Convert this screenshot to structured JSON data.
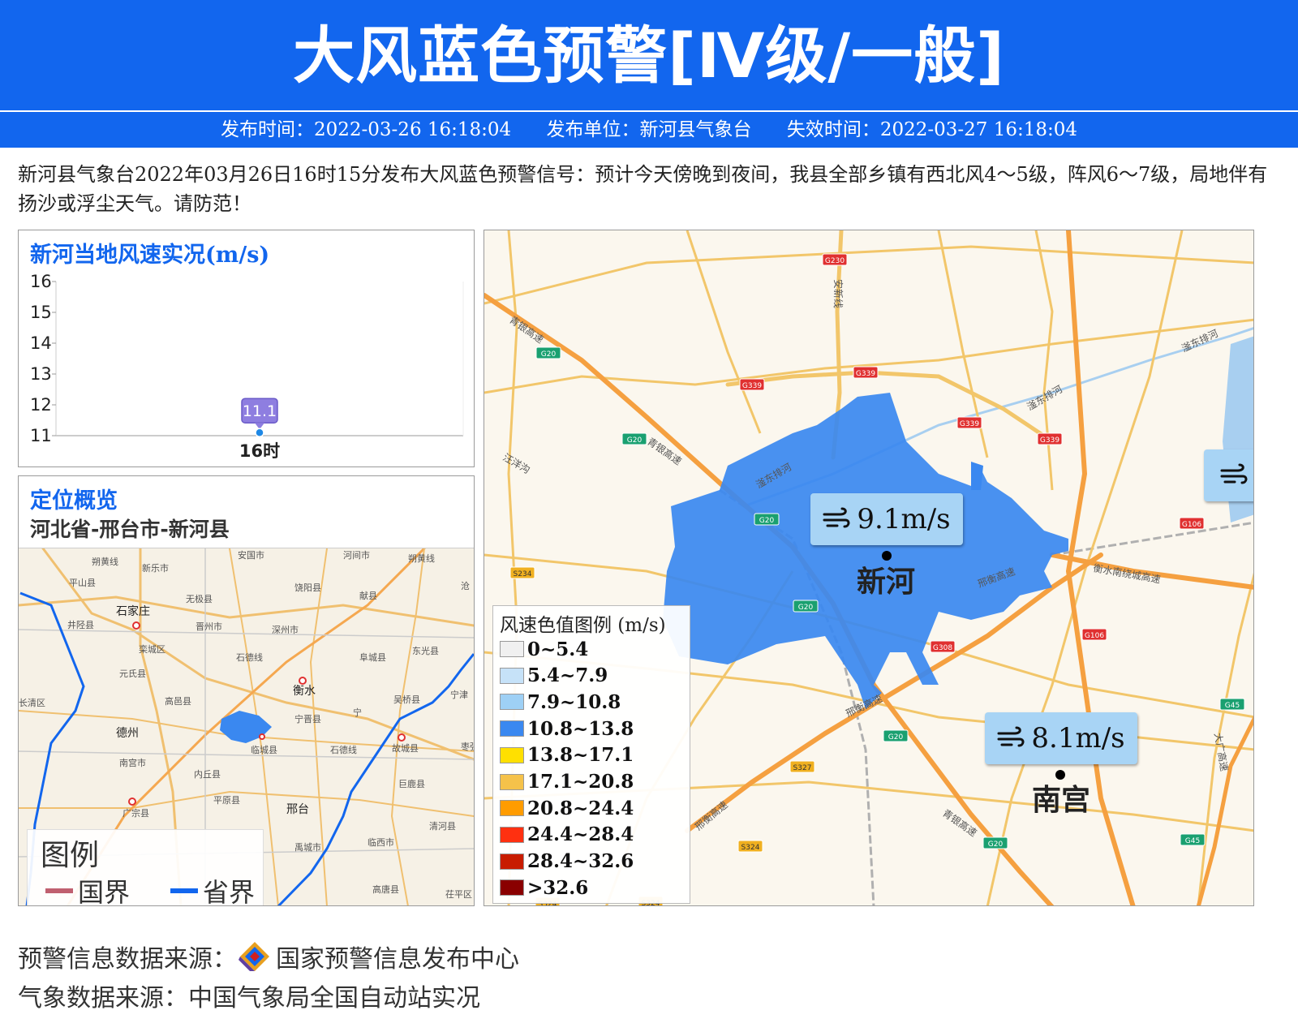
{
  "header": {
    "title": "大风蓝色预警[Ⅳ级/一般]",
    "publish_time": "发布时间：2022-03-26 16:18:04",
    "publisher": "发布单位：新河县气象台",
    "expire_time": "失效时间：2022-03-27 16:18:04"
  },
  "description": "新河县气象台2022年03月26日16时15分发布大风蓝色预警信号：预计今天傍晚到夜间，我县全部乡镇有西北风4～5级，阵风6～7级，局地伴有扬沙或浮尘天气。请防范！",
  "wind_panel": {
    "title": "新河当地风速实况(m/s)"
  },
  "chart_data": {
    "type": "line",
    "title": "新河当地风速实况(m/s)",
    "categories": [
      "16时"
    ],
    "values": [
      11.1
    ],
    "data_labels": [
      "11.1"
    ],
    "yticks": [
      "16",
      "15",
      "14",
      "13",
      "12",
      "11"
    ],
    "ylim": [
      11,
      16
    ],
    "marker_color": "#1e88e5",
    "label_bg_color": "#8e7ee0"
  },
  "location_panel": {
    "title": "定位概览",
    "path": "河北省-邢台市-新河县",
    "places": [
      "朔黄线",
      "安国市",
      "河间市",
      "朔黄线",
      "沧",
      "平山县",
      "新乐市",
      "饶阳县",
      "献县",
      "无极县",
      "石家庄",
      "井陉县",
      "晋州市",
      "深州市",
      "栾城区",
      "阜城县",
      "东光县",
      "元氏县",
      "石德线",
      "衡水",
      "吴桥县",
      "宁津",
      "高邑县",
      "宁晋县",
      "枣强县",
      "宁",
      "石德线",
      "故城县",
      "德州",
      "临城县",
      "南宫市",
      "内丘县",
      "巨鹿县",
      "平原县",
      "广宗县",
      "邢台",
      "清河县",
      "禹城市",
      "临西市",
      "高唐县",
      "茌平区",
      "长清区",
      "县"
    ],
    "legend_title": "图例",
    "legend_items": [
      {
        "label": "国界",
        "color": "#c06070"
      },
      {
        "label": "省界",
        "color": "#1266ee"
      }
    ]
  },
  "map": {
    "road_labels": [
      "G230",
      "G20",
      "G339",
      "G339",
      "G339",
      "G339",
      "G20",
      "G20",
      "G106",
      "S234",
      "G20",
      "G308",
      "G106",
      "G45",
      "G20",
      "S327",
      "S324",
      "G20",
      "G45",
      "S324",
      "S324"
    ],
    "road_names": [
      "安新线",
      "青银高速",
      "青银高速",
      "滏东排河",
      "滏东排河",
      "汪洋沟",
      "滏东排河",
      "衡水南绕城高速",
      "邢衡高速",
      "邢衡高速",
      "青银高速",
      "邢衡高速",
      "大广高速"
    ],
    "stations": [
      {
        "name": "新河",
        "wind": "9.1m/s"
      },
      {
        "name": "南宫",
        "wind": "8.1m/s"
      }
    ],
    "legend_title": "风速色值图例 (m/s)",
    "legend_items": [
      {
        "label": "0~5.4",
        "color": "#f0f0f0"
      },
      {
        "label": "5.4~7.9",
        "color": "#c6e2f8"
      },
      {
        "label": "7.9~10.8",
        "color": "#9ed0f5"
      },
      {
        "label": "10.8~13.8",
        "color": "#3a88f0"
      },
      {
        "label": "13.8~17.1",
        "color": "#ffe000"
      },
      {
        "label": "17.1~20.8",
        "color": "#f5c24a"
      },
      {
        "label": "20.8~24.4",
        "color": "#ff9c00"
      },
      {
        "label": "24.4~28.4",
        "color": "#ff3010"
      },
      {
        "label": "28.4~32.6",
        "color": "#c81c00"
      },
      {
        "label": ">32.6",
        "color": "#8a0000"
      }
    ]
  },
  "footer": {
    "warning_source": "预警信息数据来源：",
    "warning_source_org": "国家预警信息发布中心",
    "weather_source": "气象数据来源：中国气象局全国自动站实况"
  }
}
